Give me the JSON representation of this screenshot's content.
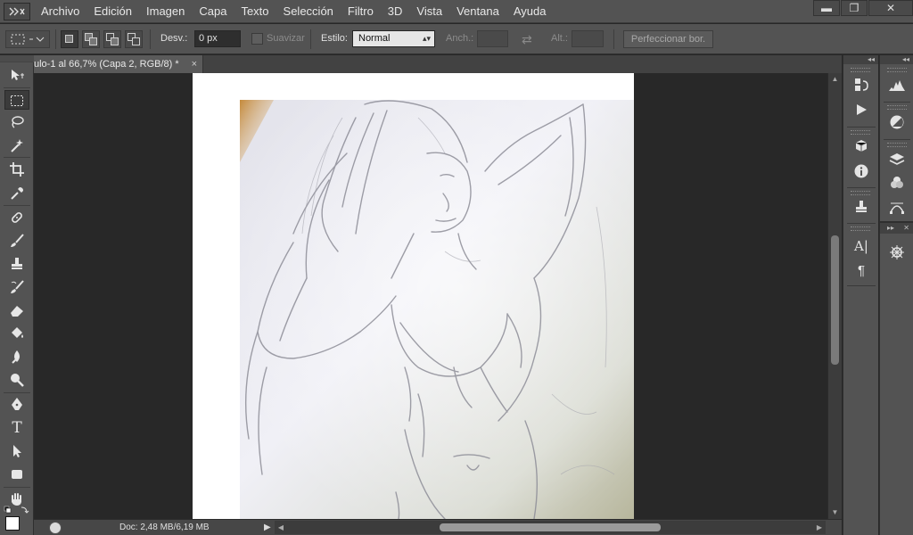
{
  "menubar": {
    "items": [
      "Archivo",
      "Edición",
      "Imagen",
      "Capa",
      "Texto",
      "Selección",
      "Filtro",
      "3D",
      "Vista",
      "Ventana",
      "Ayuda"
    ],
    "window_controls": {
      "minimize": "▬",
      "restore": "❐",
      "close": "✕"
    }
  },
  "options": {
    "desvanecer_label": "Desv.:",
    "desvanecer_value": "0 px",
    "suavizar_label": "Suavizar",
    "estilo_label": "Estilo:",
    "estilo_value": "Normal",
    "anchura_label": "Anch.:",
    "altura_label": "Alt.:",
    "refine_button": "Perfeccionar bor."
  },
  "document": {
    "tab_title": "ulo-1 al 66,7% (Capa 2, RGB/8) *",
    "tab_close": "×"
  },
  "status": {
    "doc_size": "Doc: 2,48 MB/6,19 MB",
    "menu_arrow": "▶"
  },
  "toolbar": {
    "tools": [
      "move-tool",
      "rectangular-marquee-tool",
      "lasso-tool",
      "magic-wand-tool",
      "crop-tool",
      "eyedropper-tool",
      "spot-healing-tool",
      "brush-tool",
      "clone-stamp-tool",
      "history-brush-tool",
      "eraser-tool",
      "paint-bucket-tool",
      "blur-tool",
      "dodge-tool",
      "pen-tool",
      "type-tool",
      "path-selection-tool",
      "rectangle-tool",
      "hand-tool",
      "zoom-tool"
    ],
    "active_tool": "rectangular-marquee-tool"
  },
  "colors": {
    "foreground": "#ffffff",
    "background": "#ffffff",
    "ui_panel": "#535353",
    "canvas_bg": "#282828"
  }
}
